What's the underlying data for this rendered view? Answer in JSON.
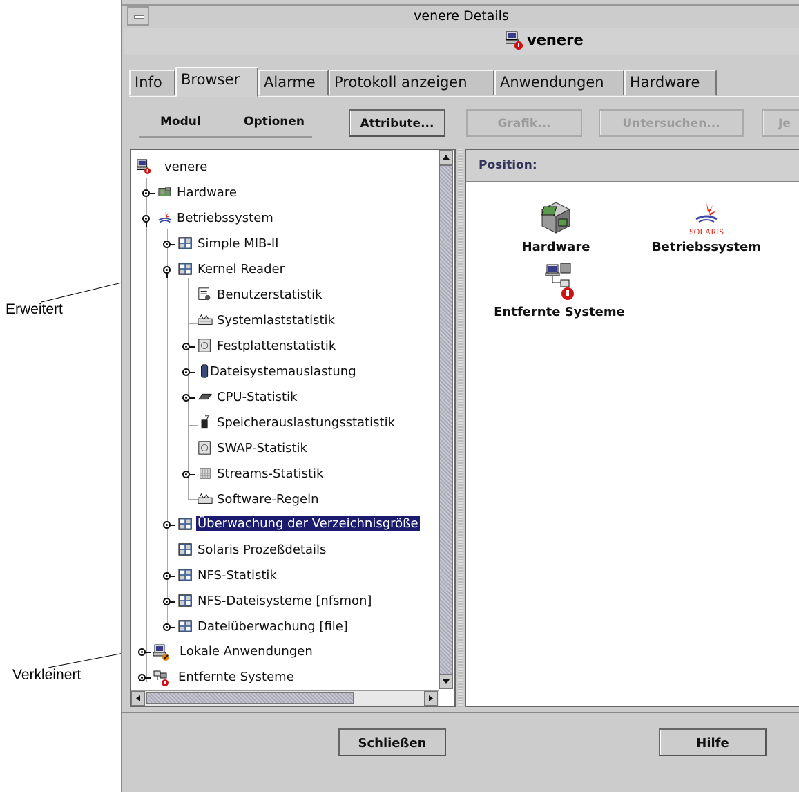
{
  "callouts": {
    "expanded": "Erweitert",
    "collapsed": "Verkleinert"
  },
  "window": {
    "title": "venere Details",
    "host": "venere"
  },
  "tabs": [
    {
      "label": "Info"
    },
    {
      "label": "Browser"
    },
    {
      "label": "Alarme"
    },
    {
      "label": "Protokoll anzeigen"
    },
    {
      "label": "Anwendungen"
    },
    {
      "label": "Hardware"
    }
  ],
  "toolbar": {
    "menu_module": "Modul",
    "menu_options": "Optionen",
    "attributes": "Attribute...",
    "graph": "Grafik...",
    "probe": "Untersuchen...",
    "cut": "Je"
  },
  "tree": {
    "root": "venere",
    "items": [
      {
        "label": "Hardware"
      },
      {
        "label": "Betriebssystem"
      },
      {
        "label": "Simple MIB-II"
      },
      {
        "label": "Kernel Reader"
      },
      {
        "label": "Benutzerstatistik"
      },
      {
        "label": "Systemlaststatistik"
      },
      {
        "label": "Festplattenstatistik"
      },
      {
        "label": "Dateisystemauslastung"
      },
      {
        "label": "CPU-Statistik"
      },
      {
        "label": "Speicherauslastungsstatistik"
      },
      {
        "label": "SWAP-Statistik"
      },
      {
        "label": "Streams-Statistik"
      },
      {
        "label": "Software-Regeln"
      },
      {
        "label": "Überwachung der Verzeichnisgröße"
      },
      {
        "label": "Solaris Prozeßdetails"
      },
      {
        "label": "NFS-Statistik"
      },
      {
        "label": "NFS-Dateisysteme [nfsmon]"
      },
      {
        "label": "Dateiüberwachung [file]"
      },
      {
        "label": "Lokale Anwendungen"
      },
      {
        "label": "Entfernte Systeme"
      }
    ]
  },
  "right": {
    "position_label": "Position:",
    "icons": [
      {
        "label": "Hardware"
      },
      {
        "label": "Betriebssystem"
      },
      {
        "label": "Entfernte Systeme"
      }
    ],
    "solaris_logo_text": "SOLARIS"
  },
  "buttons": {
    "close": "Schließen",
    "help": "Hilfe"
  },
  "colors": {
    "selection": "#1a1a6e",
    "alarm_red": "#d01010",
    "solaris_red": "#e02010"
  }
}
